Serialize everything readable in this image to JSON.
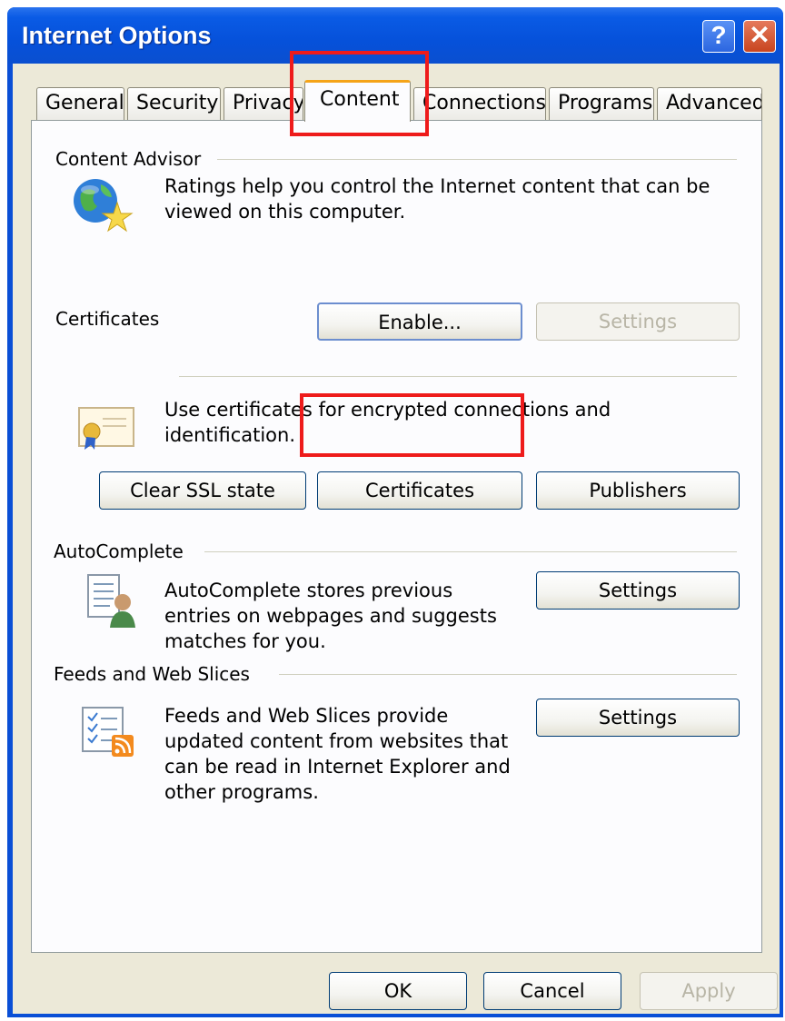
{
  "window": {
    "title": "Internet Options",
    "help_label": "?",
    "close_label": "✕"
  },
  "tabs": [
    {
      "label": "General"
    },
    {
      "label": "Security"
    },
    {
      "label": "Privacy"
    },
    {
      "label": "Content",
      "active": true
    },
    {
      "label": "Connections"
    },
    {
      "label": "Programs"
    },
    {
      "label": "Advanced"
    }
  ],
  "content_advisor": {
    "title": "Content Advisor",
    "description": "Ratings help you control the Internet content that can be viewed on this computer.",
    "enable_label": "Enable...",
    "settings_label": "Settings",
    "icon": "globe-star-icon"
  },
  "certificates": {
    "title": "Certificates",
    "description": "Use certificates for encrypted connections and identification.",
    "clear_ssl_label": "Clear SSL state",
    "certificates_label": "Certificates",
    "publishers_label": "Publishers",
    "icon": "certificate-icon"
  },
  "autocomplete": {
    "title": "AutoComplete",
    "description": "AutoComplete stores previous entries on webpages and suggests matches for you.",
    "settings_label": "Settings",
    "icon": "autocomplete-icon"
  },
  "feeds": {
    "title": "Feeds and Web Slices",
    "description": "Feeds and Web Slices provide updated content from websites that can be read in Internet Explorer and other programs.",
    "settings_label": "Settings",
    "icon": "rss-feed-icon"
  },
  "footer": {
    "ok_label": "OK",
    "cancel_label": "Cancel",
    "apply_label": "Apply"
  },
  "annotation_color": "#ee1b1b"
}
